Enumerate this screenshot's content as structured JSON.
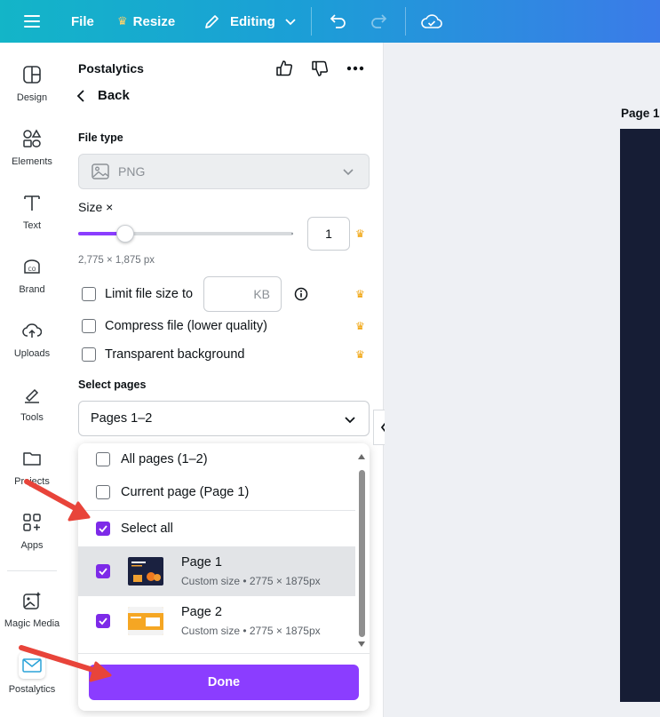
{
  "topbar": {
    "file_label": "File",
    "resize_label": "Resize",
    "editing_label": "Editing"
  },
  "rail": {
    "items": [
      {
        "label": "Design",
        "icon": "design-icon"
      },
      {
        "label": "Elements",
        "icon": "elements-icon"
      },
      {
        "label": "Text",
        "icon": "text-icon"
      },
      {
        "label": "Brand",
        "icon": "brand-icon"
      },
      {
        "label": "Uploads",
        "icon": "uploads-icon"
      },
      {
        "label": "Tools",
        "icon": "tools-icon"
      },
      {
        "label": "Projects",
        "icon": "folder-icon"
      },
      {
        "label": "Apps",
        "icon": "apps-icon"
      },
      {
        "label": "Magic Media",
        "icon": "magic-media-icon"
      },
      {
        "label": "Postalytics",
        "icon": "postalytics-icon"
      }
    ]
  },
  "panel": {
    "title": "Postalytics",
    "back_label": "Back",
    "file_type_label": "File type",
    "file_type_value": "PNG",
    "size_label": "Size ×",
    "size_value": "1",
    "size_fraction": 0.22,
    "dimensions": "2,775 × 1,875 px",
    "limit_label": "Limit file size to",
    "kb_placeholder": "KB",
    "compress_label": "Compress file (lower quality)",
    "transparent_label": "Transparent background",
    "select_pages_label": "Select pages",
    "select_pages_value": "Pages 1–2"
  },
  "dropdown": {
    "all_pages": "All pages (1–2)",
    "current_page": "Current page (Page 1)",
    "select_all": "Select all",
    "pages": [
      {
        "name": "Page 1",
        "sub": "Custom size • 2775 × 1875px",
        "checked": true,
        "selected": true
      },
      {
        "name": "Page 2",
        "sub": "Custom size • 2775 × 1875px",
        "checked": true,
        "selected": false
      }
    ],
    "done_label": "Done"
  },
  "canvas": {
    "page_label": "Page 1"
  },
  "colors": {
    "accent": "#8b3dff",
    "check": "#7d2ae8",
    "crown": "#f0a30a",
    "arrow": "#e8443a"
  }
}
